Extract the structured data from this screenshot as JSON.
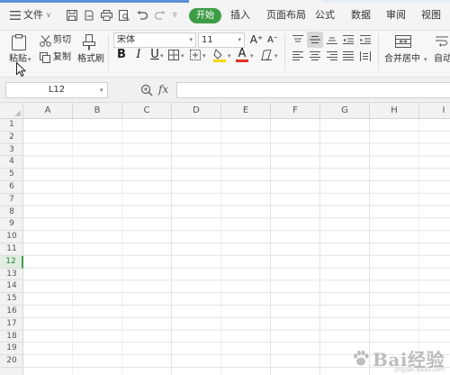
{
  "menubar": {
    "menu_label": "文件",
    "tabs": [
      "开始",
      "插入",
      "页面布局",
      "公式",
      "数据",
      "审阅",
      "视图"
    ],
    "active_tab": "开始"
  },
  "ribbon": {
    "paste_label": "粘贴",
    "cut_label": "剪切",
    "copy_label": "复制",
    "format_painter_label": "格式刷",
    "font_name": "宋体",
    "font_size": "11",
    "grow_font": "A⁺",
    "shrink_font": "A⁻",
    "bold": "B",
    "italic": "I",
    "underline": "U",
    "font_color_glyph": "A",
    "merge_center_label": "合并居中",
    "autowrap_label": "自动"
  },
  "formula_bar": {
    "name_box": "L12",
    "zoom_icon": "zoom-icon",
    "fx_label": "fx",
    "formula_value": ""
  },
  "sheet": {
    "columns": [
      "A",
      "B",
      "C",
      "D",
      "E",
      "F",
      "G",
      "H",
      "I"
    ],
    "rows": [
      "1",
      "2",
      "3",
      "4",
      "5",
      "6",
      "7",
      "8",
      "9",
      "10",
      "11",
      "12",
      "13",
      "14",
      "15",
      "16",
      "17",
      "18",
      "19",
      "20"
    ],
    "active_row": "12"
  },
  "watermark": {
    "text": "Bai经验",
    "sub": "jingyan.baidu.com"
  },
  "colors": {
    "accent_green": "#3f9c46",
    "font_color_red": "#e0321e",
    "highlight_yellow": "#f5d800"
  }
}
